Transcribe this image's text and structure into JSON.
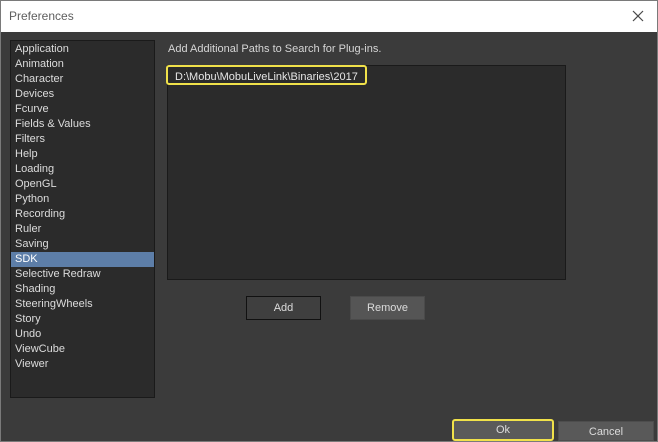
{
  "window": {
    "title": "Preferences"
  },
  "sidebar": {
    "items": [
      {
        "label": "Application"
      },
      {
        "label": "Animation"
      },
      {
        "label": "Character"
      },
      {
        "label": "Devices"
      },
      {
        "label": "Fcurve"
      },
      {
        "label": "Fields & Values"
      },
      {
        "label": "Filters"
      },
      {
        "label": "Help"
      },
      {
        "label": "Loading"
      },
      {
        "label": "OpenGL"
      },
      {
        "label": "Python"
      },
      {
        "label": "Recording"
      },
      {
        "label": "Ruler"
      },
      {
        "label": "Saving"
      },
      {
        "label": "SDK",
        "selected": true
      },
      {
        "label": "Selective Redraw"
      },
      {
        "label": "Shading"
      },
      {
        "label": "SteeringWheels"
      },
      {
        "label": "Story"
      },
      {
        "label": "Undo"
      },
      {
        "label": "ViewCube"
      },
      {
        "label": "Viewer"
      }
    ]
  },
  "sdk_panel": {
    "label": "Add Additional Paths to Search for Plug-ins.",
    "paths": [
      "D:\\Mobu\\MobuLiveLink\\Binaries\\2017"
    ],
    "add_label": "Add",
    "remove_label": "Remove"
  },
  "footer": {
    "ok_label": "Ok",
    "cancel_label": "Cancel"
  },
  "colors": {
    "highlight": "#f0e14a",
    "selection": "#5d7ea8"
  },
  "icons": {
    "close": "close-icon"
  }
}
